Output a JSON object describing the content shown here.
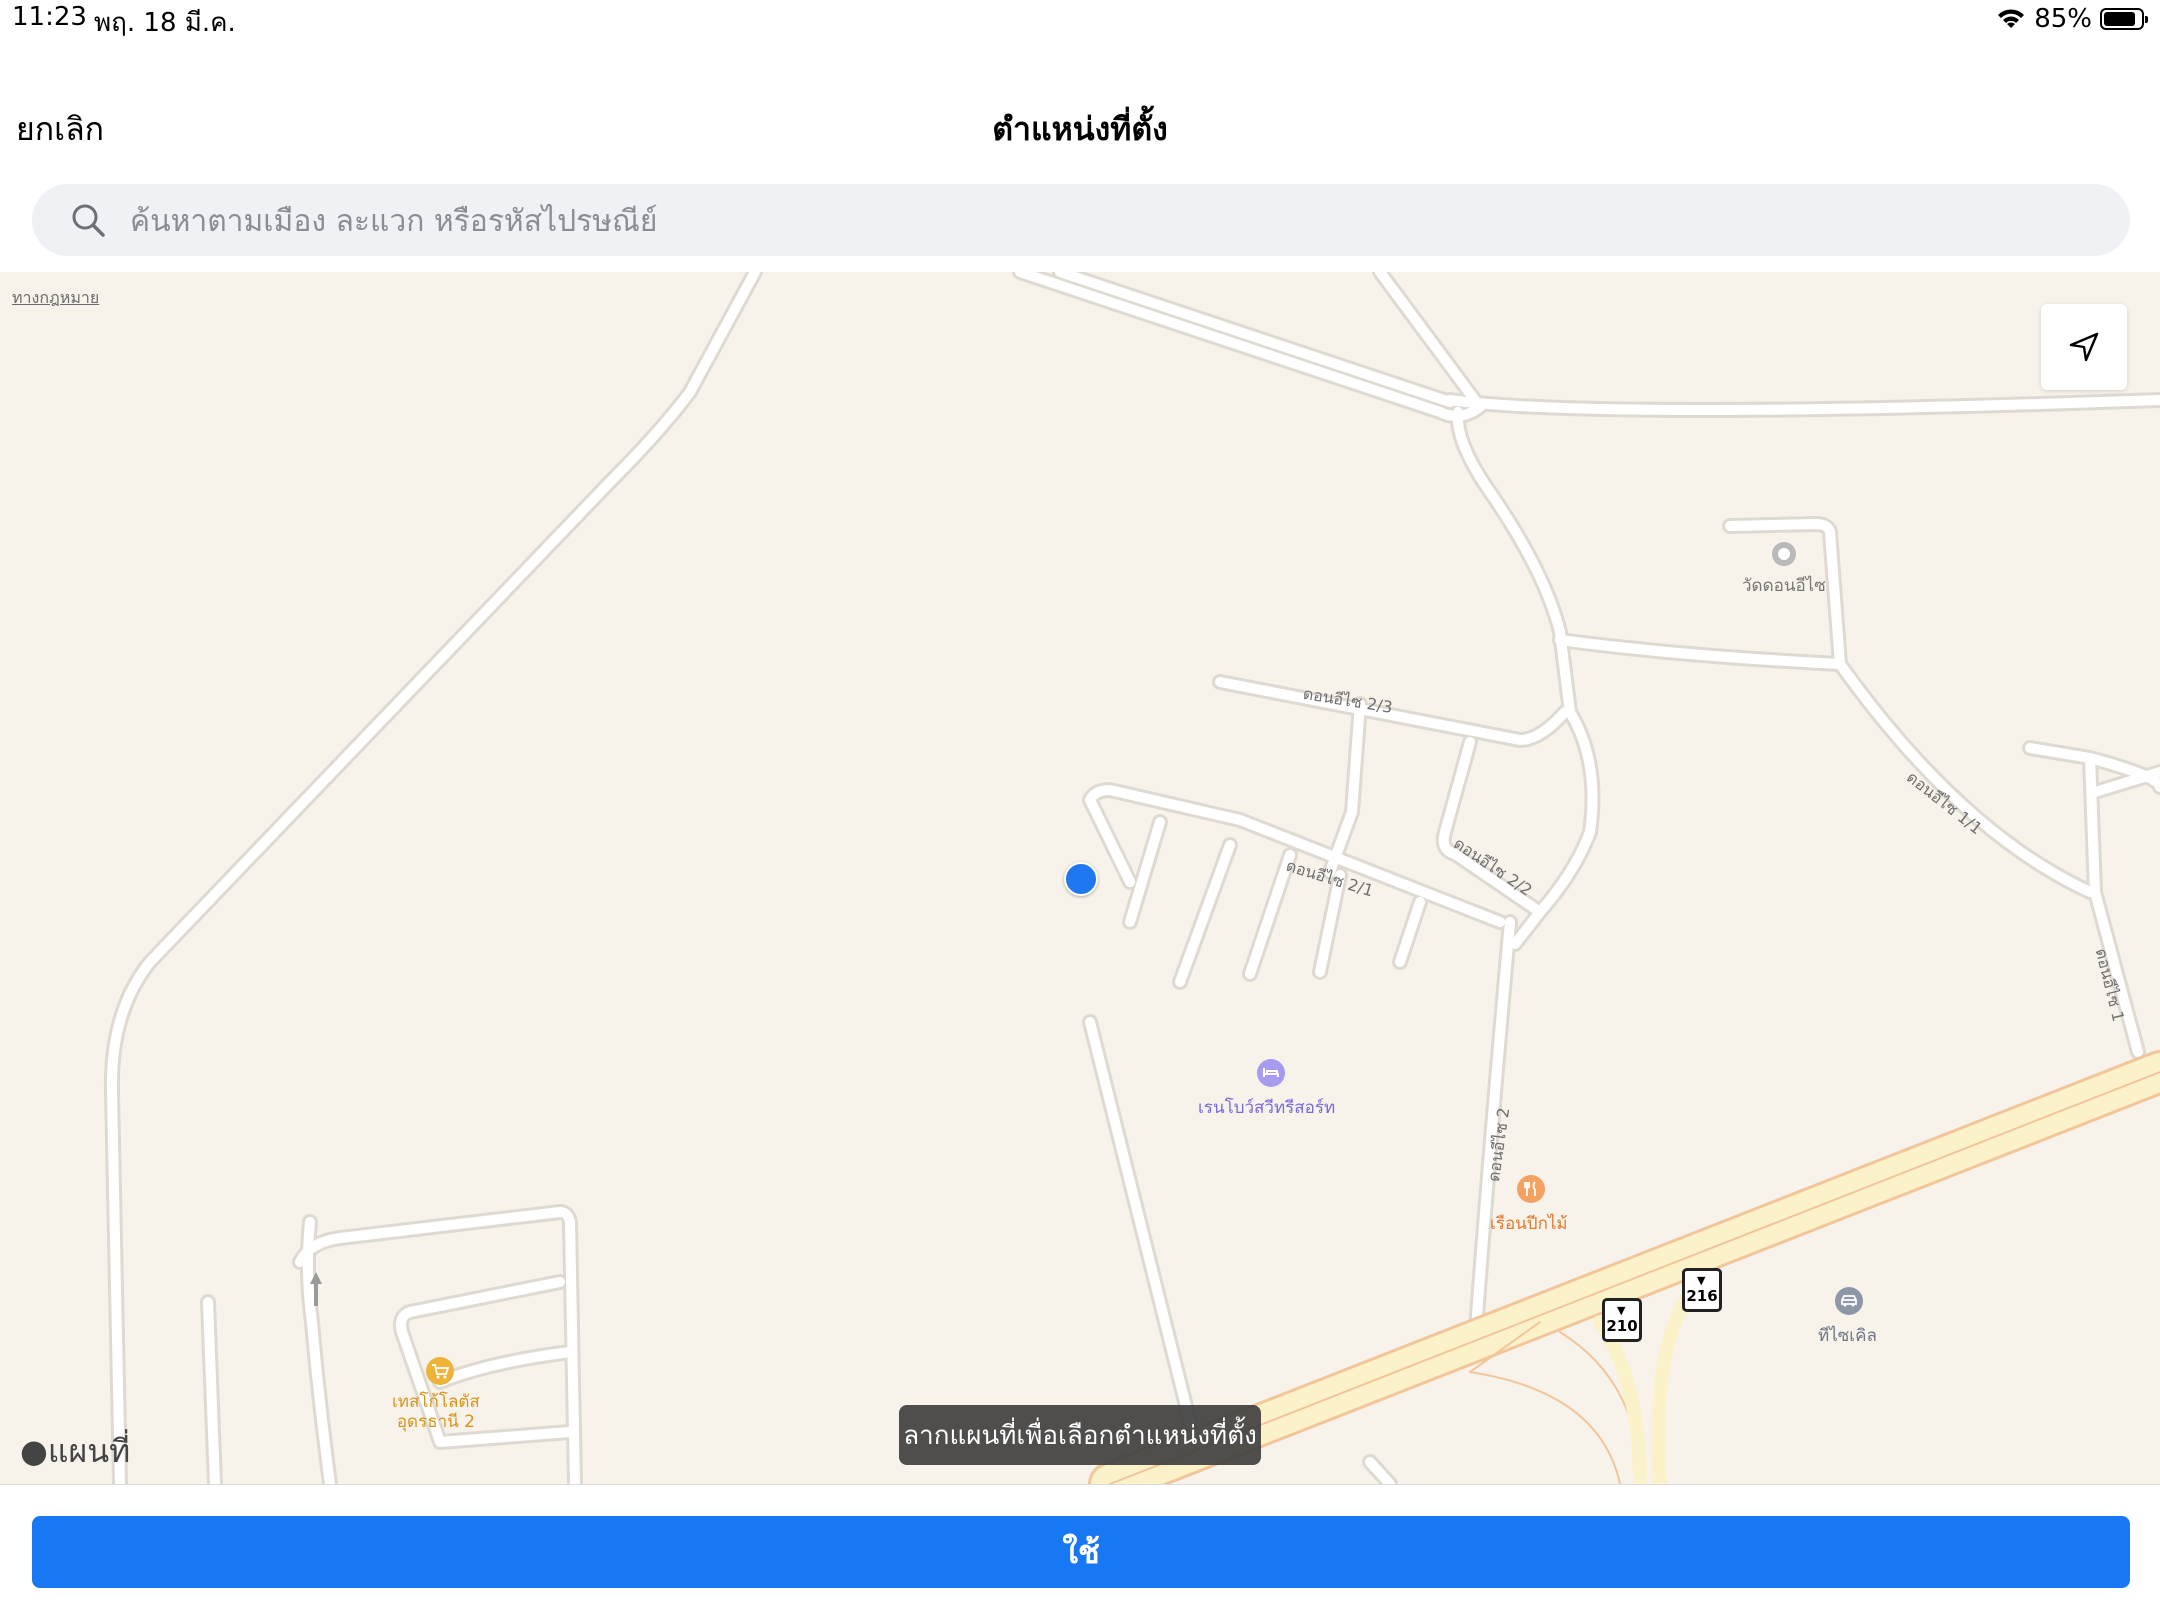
{
  "status_bar": {
    "time": "11:23",
    "date": "พฤ. 18 มี.ค.",
    "battery_text": "85%",
    "battery_level": 0.85,
    "wifi_icon": "wifi-icon"
  },
  "nav": {
    "cancel_label": "ยกเลิก",
    "title": "ตำแหน่งที่ตั้ง"
  },
  "search": {
    "placeholder": "ค้นหาตามเมือง ละแวก หรือรหัสไปรษณีย์",
    "value": "",
    "icon": "search-icon"
  },
  "map": {
    "legal_label": "ทางกฎหมาย",
    "locate_icon": "location-arrow-icon",
    "roads": {
      "r23": "ดอนอีไซ 2/3",
      "r21": "ดอนอีไซ 2/1",
      "r22": "ดอนอีไซ 2/2",
      "r11": "ดอนอีไซ 1/1",
      "r2": "ดอนอีไซ 2",
      "r1": "ดอนอีไซ 1"
    },
    "pois": {
      "temple": "วัดดอนอีไซ",
      "resort": "เรนโบว์สวีทรีสอร์ท",
      "restaurant": "เรือนปีกไม้",
      "car_service": "ทีไซเคิล",
      "tesco_line1": "เทสโก้โลตัส",
      "tesco_line2": "อุดรธานี 2"
    },
    "highway_shields": {
      "a": "210",
      "b": "216"
    },
    "brand_label": "แผนที่",
    "hint": "ลากแผนที่เพื่อเลือกตำแหน่งที่ตั้ง",
    "colors": {
      "land": "#f7f3eb",
      "road": "#ffffff",
      "road_edge": "#dedad2",
      "highway": "#fbf2c9",
      "highway_edge": "#f2c59a",
      "pin": "#1f78f0"
    }
  },
  "footer": {
    "use_label": "ใช้",
    "accent": "#1877f2"
  }
}
